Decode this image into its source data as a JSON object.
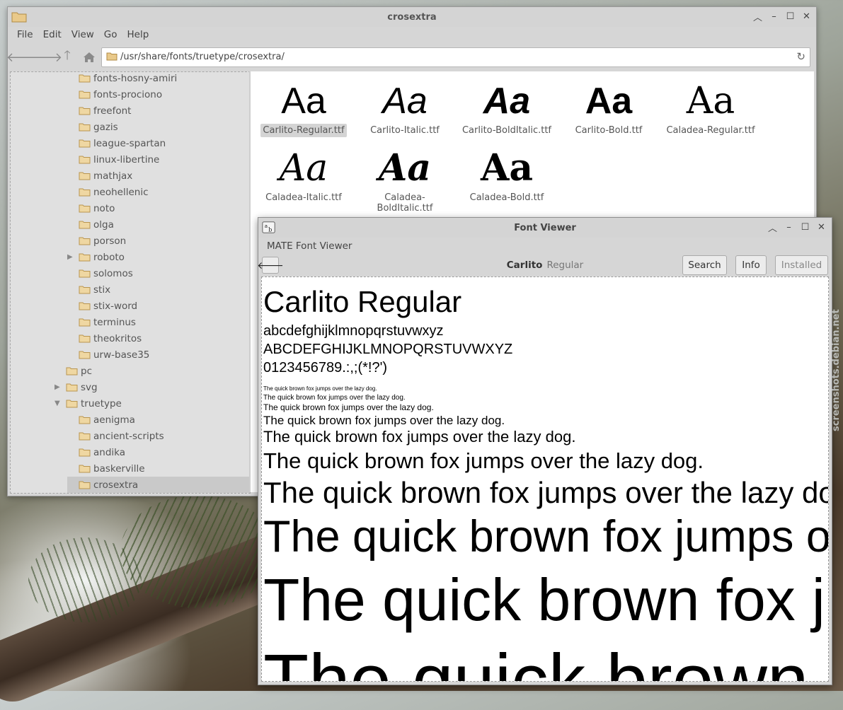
{
  "file_manager": {
    "title": "crosextra",
    "menu": [
      "File",
      "Edit",
      "View",
      "Go",
      "Help"
    ],
    "address": "/usr/share/fonts/truetype/crosextra/",
    "tree": [
      {
        "label": "fonts-hosny-amiri",
        "level": 2,
        "expander": ""
      },
      {
        "label": "fonts-prociono",
        "level": 2,
        "expander": ""
      },
      {
        "label": "freefont",
        "level": 2,
        "expander": ""
      },
      {
        "label": "gazis",
        "level": 2,
        "expander": ""
      },
      {
        "label": "league-spartan",
        "level": 2,
        "expander": ""
      },
      {
        "label": "linux-libertine",
        "level": 2,
        "expander": ""
      },
      {
        "label": "mathjax",
        "level": 2,
        "expander": ""
      },
      {
        "label": "neohellenic",
        "level": 2,
        "expander": ""
      },
      {
        "label": "noto",
        "level": 2,
        "expander": ""
      },
      {
        "label": "olga",
        "level": 2,
        "expander": ""
      },
      {
        "label": "porson",
        "level": 2,
        "expander": ""
      },
      {
        "label": "roboto",
        "level": 2,
        "expander": "▶"
      },
      {
        "label": "solomos",
        "level": 2,
        "expander": ""
      },
      {
        "label": "stix",
        "level": 2,
        "expander": ""
      },
      {
        "label": "stix-word",
        "level": 2,
        "expander": ""
      },
      {
        "label": "terminus",
        "level": 2,
        "expander": ""
      },
      {
        "label": "theokritos",
        "level": 2,
        "expander": ""
      },
      {
        "label": "urw-base35",
        "level": 2,
        "expander": ""
      },
      {
        "label": "pc",
        "level": 1,
        "expander": ""
      },
      {
        "label": "svg",
        "level": 1,
        "expander": "▶"
      },
      {
        "label": "truetype",
        "level": 1,
        "expander": "▼"
      },
      {
        "label": "aenigma",
        "level": 2,
        "expander": ""
      },
      {
        "label": "ancient-scripts",
        "level": 2,
        "expander": ""
      },
      {
        "label": "andika",
        "level": 2,
        "expander": ""
      },
      {
        "label": "baskerville",
        "level": 2,
        "expander": ""
      },
      {
        "label": "crosextra",
        "level": 2,
        "expander": "",
        "selected": true
      }
    ],
    "files": [
      {
        "name": "Carlito-Regular.ttf",
        "glyph": "Aa",
        "family": "sans",
        "weight": "normal",
        "style": "normal",
        "selected": true
      },
      {
        "name": "Carlito-Italic.ttf",
        "glyph": "Aa",
        "family": "sans",
        "weight": "normal",
        "style": "italic"
      },
      {
        "name": "Carlito-BoldItalic.ttf",
        "glyph": "Aa",
        "family": "sans",
        "weight": "bold",
        "style": "italic"
      },
      {
        "name": "Carlito-Bold.ttf",
        "glyph": "Aa",
        "family": "sans",
        "weight": "bold",
        "style": "normal"
      },
      {
        "name": "Caladea-Regular.ttf",
        "glyph": "Aa",
        "family": "serif",
        "weight": "normal",
        "style": "normal"
      },
      {
        "name": "Caladea-Italic.ttf",
        "glyph": "Aa",
        "family": "serif",
        "weight": "normal",
        "style": "italic"
      },
      {
        "name": "Caladea-\nBoldItalic.ttf",
        "glyph": "Aa",
        "family": "serif",
        "weight": "bold",
        "style": "italic"
      },
      {
        "name": "Caladea-Bold.ttf",
        "glyph": "Aa",
        "family": "serif",
        "weight": "bold",
        "style": "normal"
      }
    ]
  },
  "font_viewer": {
    "title": "Font Viewer",
    "app_menu": "MATE Font Viewer",
    "font_family": "Carlito",
    "font_style": "Regular",
    "buttons": {
      "search": "Search",
      "info": "Info",
      "installed": "Installed"
    },
    "preview": {
      "heading": "Carlito Regular",
      "lowercase": "abcdefghijklmnopqrstuvwxyz",
      "uppercase": "ABCDEFGHIJKLMNOPQRSTUVWXYZ",
      "digits": "0123456789.:,;(*!?')",
      "pangram": "The quick brown fox jumps over the lazy dog."
    }
  }
}
